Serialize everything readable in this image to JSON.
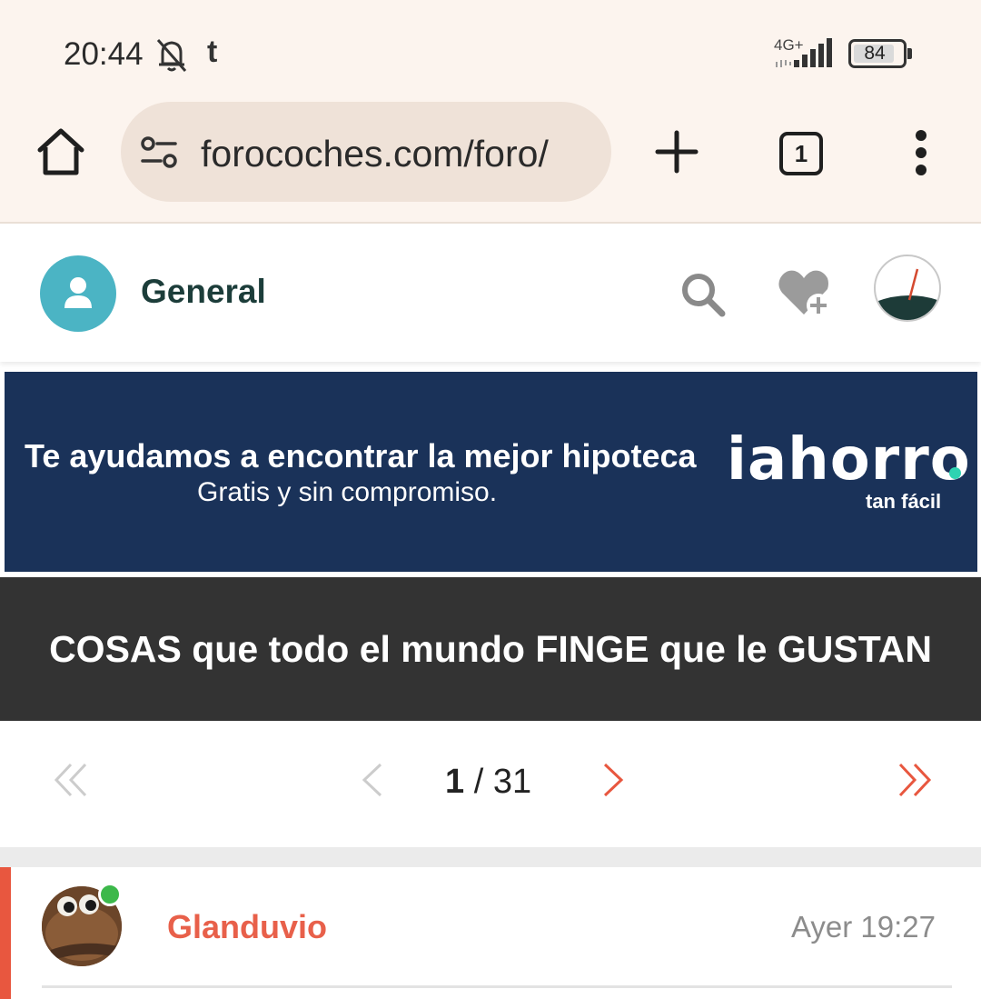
{
  "status_bar": {
    "time": "20:44",
    "carrier_icon": "t",
    "network": "4G+",
    "battery": "84",
    "battery_level": 0.84
  },
  "browser": {
    "url": "forocoches.com/foro/",
    "tab_count": "1"
  },
  "forum_header": {
    "category": "General"
  },
  "ad": {
    "headline": "Te ayudamos a encontrar la mejor hipoteca",
    "subline": "Gratis y sin compromiso.",
    "logo": "iahorro",
    "tagline": "tan fácil"
  },
  "thread": {
    "title": "COSAS que todo el mundo FINGE que le GUSTAN"
  },
  "pagination": {
    "current": "1",
    "separator": " / ",
    "total": "31"
  },
  "post": {
    "username": "Glanduvio",
    "date": "Ayer 19:27"
  },
  "colors": {
    "accent": "#e8573f",
    "ad_background": "#1a3259",
    "title_background": "#333333",
    "category_avatar": "#4bb4c4",
    "online": "#3cb84a"
  }
}
